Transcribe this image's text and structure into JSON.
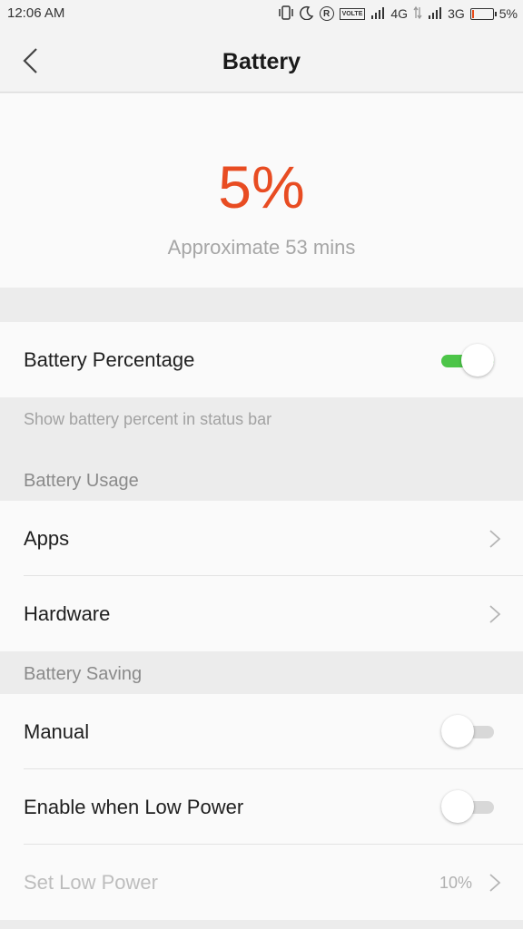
{
  "status_bar": {
    "time": "12:06 AM",
    "volte": "VOLTE",
    "net1": "4G",
    "net2": "3G",
    "battery_text": "5%",
    "battery_level_percent": 5,
    "icons": [
      "vibrate-icon",
      "moon-icon",
      "roaming-r-icon",
      "volte-icon",
      "signal-icon",
      "data-arrows-icon",
      "battery-icon"
    ]
  },
  "header": {
    "title": "Battery",
    "back_icon": "chevron-left-icon"
  },
  "summary": {
    "percent": "5%",
    "approx": "Approximate 53 mins",
    "accent_color": "#e84c22"
  },
  "battery_percentage": {
    "label": "Battery Percentage",
    "enabled": true,
    "hint": "Show battery percent in status bar",
    "toggle_on_color": "#4cc548"
  },
  "usage": {
    "heading": "Battery Usage",
    "items": [
      {
        "label": "Apps"
      },
      {
        "label": "Hardware"
      }
    ]
  },
  "saving": {
    "heading": "Battery Saving",
    "manual": {
      "label": "Manual",
      "enabled": false
    },
    "low_power": {
      "label": "Enable when Low Power",
      "enabled": false
    },
    "set_low_power": {
      "label": "Set Low Power",
      "value": "10%"
    }
  }
}
